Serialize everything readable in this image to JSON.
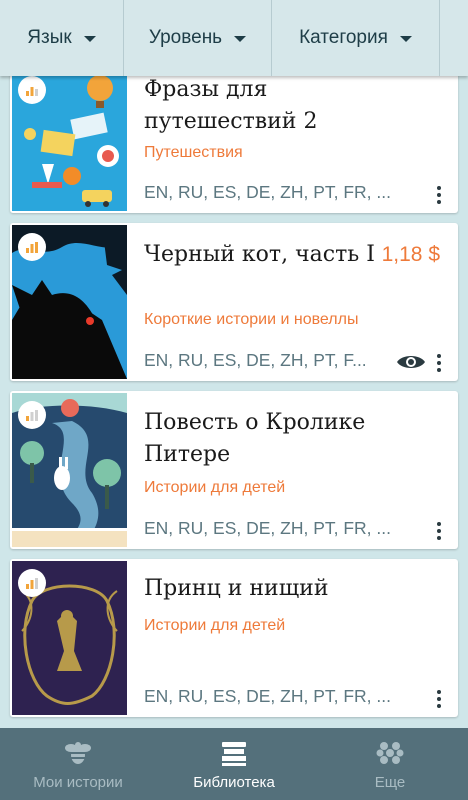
{
  "filters": {
    "language": "Язык",
    "level": "Уровень",
    "category": "Категория"
  },
  "books": [
    {
      "title": "Фразы для путешествий 2",
      "category": "Путешествия",
      "languages": "EN, RU, ES, DE, ZH, PT, FR, ...",
      "price": "",
      "icon": "travel-cover"
    },
    {
      "title": "Черный кот, часть I",
      "category": "Короткие истории и новеллы",
      "languages": "EN, RU, ES, DE, ZH, PT, F...",
      "price": "1,18 $",
      "icon": "black-cat-cover"
    },
    {
      "title": "Повесть о Кролике Питере",
      "category": "Истории для детей",
      "languages": "EN, RU, ES, DE, ZH, PT, FR, ...",
      "price": "",
      "icon": "rabbit-cover"
    },
    {
      "title": "Принц и нищий",
      "category": "Истории для детей",
      "languages": "EN, RU, ES, DE, ZH, PT, FR, ...",
      "price": "",
      "icon": "prince-cover"
    }
  ],
  "nav": {
    "my_stories": "Мои истории",
    "library": "Библиотека",
    "more": "Еще"
  },
  "colors": {
    "accent": "#ee7a3a",
    "nav_bg": "#54707b",
    "background": "#cfe6e9"
  }
}
